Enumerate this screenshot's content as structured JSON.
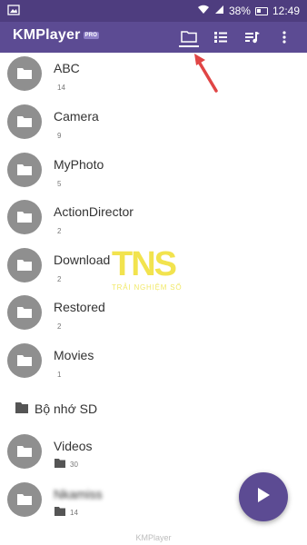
{
  "status": {
    "battery": "38%",
    "time": "12:49"
  },
  "app": {
    "title": "KMPlayer",
    "badge": "PRO"
  },
  "toolbar": {
    "icons": [
      "folder-icon",
      "list-icon",
      "music-playlist-icon",
      "more-vertical-icon"
    ]
  },
  "folders": [
    {
      "name": "ABC",
      "count": "14"
    },
    {
      "name": "Camera",
      "count": "9"
    },
    {
      "name": "MyPhoto",
      "count": "5"
    },
    {
      "name": "ActionDirector",
      "count": "2"
    },
    {
      "name": "Download",
      "count": "2"
    },
    {
      "name": "Restored",
      "count": "2"
    },
    {
      "name": "Movies",
      "count": "1"
    }
  ],
  "sd_section": {
    "label": "Bộ nhớ SD"
  },
  "sd_folders": [
    {
      "name": "Videos",
      "count": "30"
    },
    {
      "name": "Nkamiss",
      "count": "14"
    }
  ],
  "watermark": {
    "main": "TNS",
    "sub": "TRẢI NGHIỆM SỐ"
  },
  "footer": {
    "label": "KMPlayer"
  },
  "colors": {
    "accent": "#5c4b93",
    "status_bar": "#4e3d7f",
    "avatar": "#8f8f8f",
    "arrow": "#e04545"
  }
}
